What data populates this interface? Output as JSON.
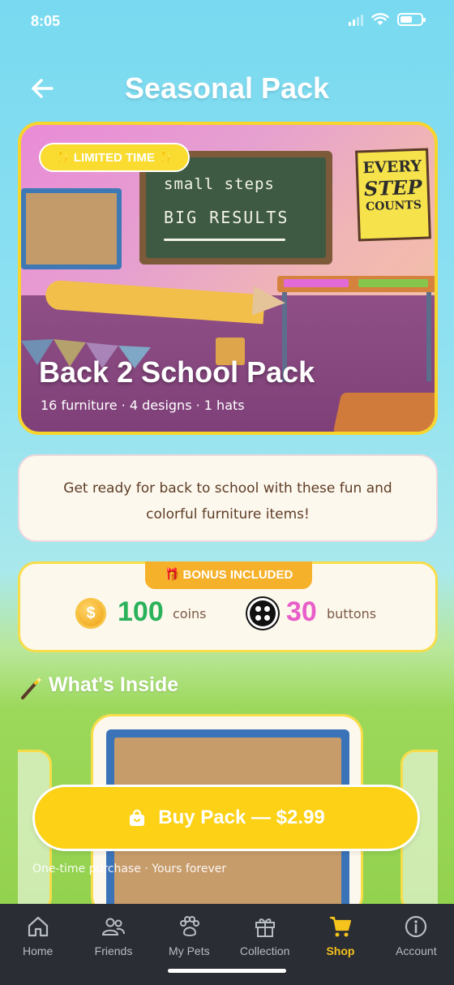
{
  "status": {
    "time": "8:05"
  },
  "header": {
    "title": "Seasonal Pack"
  },
  "hero": {
    "badge": "✨ LIMITED TIME ✨",
    "title": "Back 2 School Pack",
    "subtitle": "16 furniture · 4 designs · 1 hats",
    "chalkboard_line1": "small steps",
    "chalkboard_line2": "BIG RESULTS",
    "poster_line1": "EVERY",
    "poster_line2": "STEP",
    "poster_line3": "COUNTS"
  },
  "description": "Get ready for back to school with these fun and colorful furniture items!",
  "bonus": {
    "tab_label": "🎁 BONUS INCLUDED",
    "coins_amount": "100",
    "coins_label": "coins",
    "coin_symbol": "$",
    "buttons_amount": "30",
    "buttons_label": "buttons"
  },
  "inside": {
    "title": "What's Inside"
  },
  "buy": {
    "label": "Buy Pack — $2.99",
    "note": "One-time purchase · Yours forever"
  },
  "tabs": [
    {
      "label": "Home",
      "icon": "home-icon"
    },
    {
      "label": "Friends",
      "icon": "friends-icon"
    },
    {
      "label": "My Pets",
      "icon": "paw-icon"
    },
    {
      "label": "Collection",
      "icon": "gift-icon"
    },
    {
      "label": "Shop",
      "icon": "cart-icon",
      "active": true
    },
    {
      "label": "Account",
      "icon": "info-icon"
    }
  ],
  "colors": {
    "accent": "#fcd116",
    "active_tab": "#f6c21c",
    "coins": "#2ab25a",
    "buttons": "#e85fc9",
    "tabbar": "#2a2d33"
  }
}
